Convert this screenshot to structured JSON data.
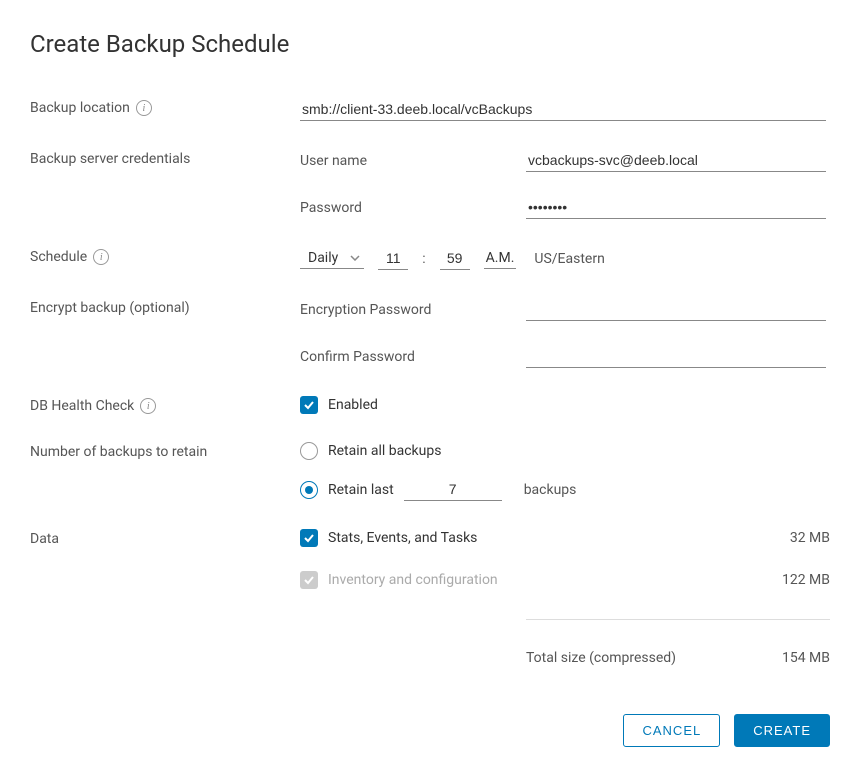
{
  "title": "Create Backup Schedule",
  "labels": {
    "backup_location": "Backup location",
    "backup_server_credentials": "Backup server credentials",
    "user_name": "User name",
    "password": "Password",
    "schedule": "Schedule",
    "encrypt_backup": "Encrypt backup (optional)",
    "encryption_password": "Encryption Password",
    "confirm_password": "Confirm Password",
    "db_health_check": "DB Health Check",
    "number_of_backups": "Number of backups to retain",
    "data": "Data"
  },
  "fields": {
    "backup_location": "smb://client-33.deeb.local/vcBackups",
    "user_name": "vcbackups-svc@deeb.local",
    "password": "••••••••",
    "schedule_frequency": "Daily",
    "schedule_hour": "11",
    "schedule_minute": "59",
    "schedule_ampm": "A.M.",
    "schedule_tz": "US/Eastern",
    "encryption_password": "",
    "confirm_password": "",
    "db_health_enabled_label": "Enabled",
    "retain_all_label": "Retain all backups",
    "retain_last_prefix": "Retain last",
    "retain_last_count": "7",
    "retain_last_suffix": "backups"
  },
  "data_section": {
    "stats_label": "Stats, Events, and Tasks",
    "stats_size": "32 MB",
    "inventory_label": "Inventory and configuration",
    "inventory_size": "122 MB",
    "total_label": "Total size (compressed)",
    "total_size": "154 MB"
  },
  "buttons": {
    "cancel": "CANCEL",
    "create": "CREATE"
  }
}
